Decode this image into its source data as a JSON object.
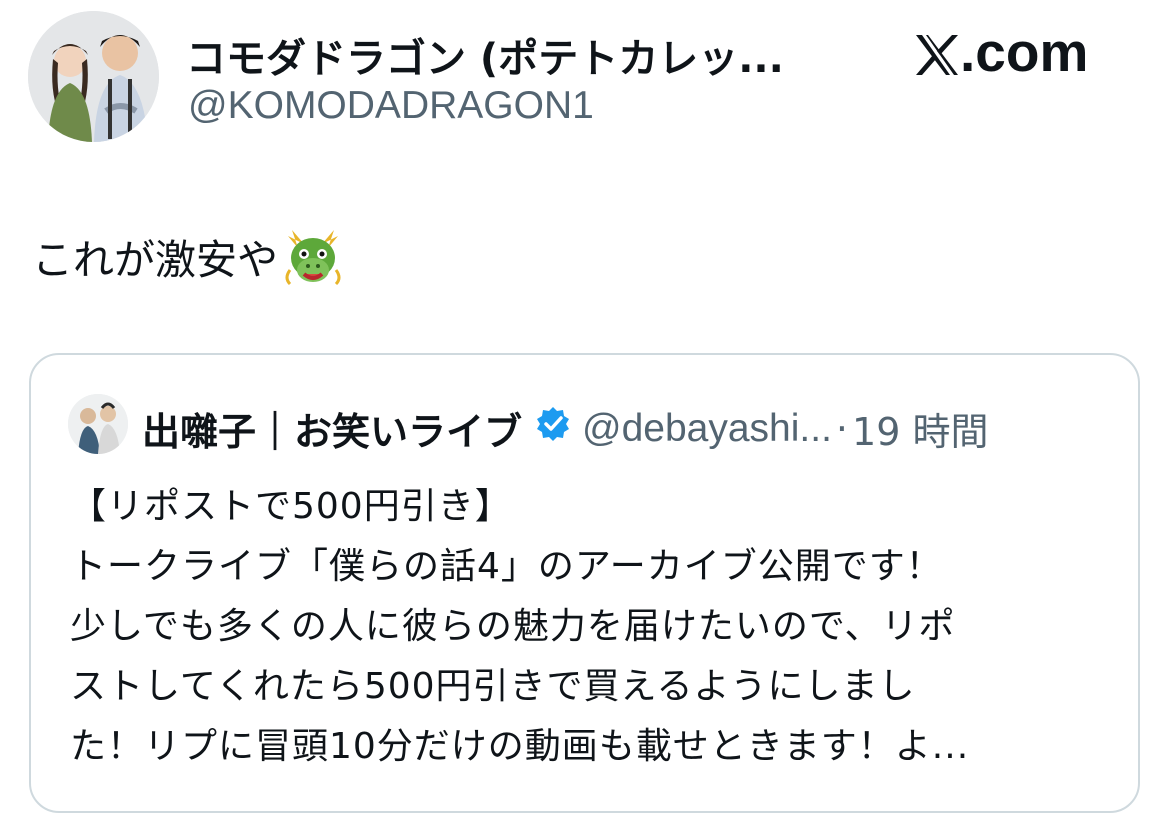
{
  "header": {
    "display_name": "コモダドラゴン (ポテトカレッ...",
    "handle": "@KOMODADRAGON1",
    "brand_label": ".com",
    "avatar_icon": "profile-photo-two-people",
    "brand_icon": "x-logo-icon"
  },
  "tweet": {
    "text": "これが激安や",
    "emoji": "dragon-face-icon"
  },
  "quote": {
    "author_name": "出囃子｜お笑いライブ",
    "verified_icon": "verified-badge-icon",
    "handle": "@debayashi...",
    "separator": "·",
    "time": "19 時間",
    "lines": [
      "【リポストで500円引き】",
      "トークライブ「僕らの話4」のアーカイブ公開です！",
      "少しでも多くの人に彼らの魅力を届けたいので、リポ",
      "ストしてくれたら500円引きで買えるようにしまし",
      "た！リプに冒頭10分だけの動画も載せときます！よ..."
    ]
  },
  "colors": {
    "text": "#0f1419",
    "secondary": "#536471",
    "border": "#cfd9de",
    "verified": "#1d9bf0"
  }
}
